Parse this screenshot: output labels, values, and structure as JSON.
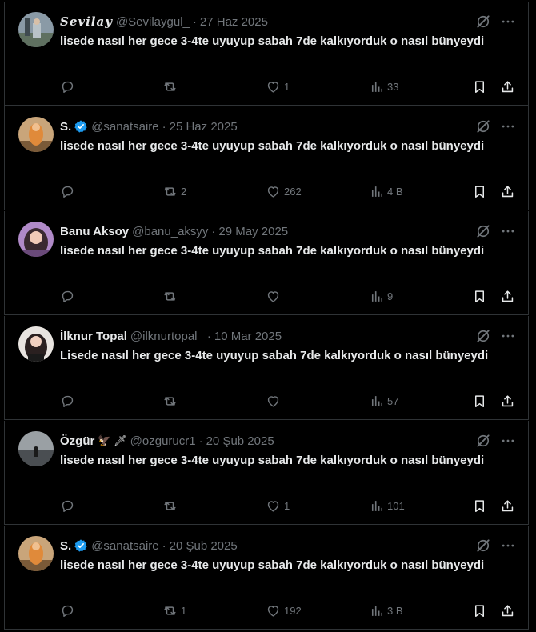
{
  "colors": {
    "background": "#000000",
    "text": "#e7e9ea",
    "muted": "#71767b",
    "border": "#2f3336",
    "verified": "#1d9bf0"
  },
  "icons": {
    "reply": "reply-icon",
    "retweet": "retweet-icon",
    "like": "heart-icon",
    "views": "views-chart-icon",
    "bookmark": "bookmark-icon",
    "share": "share-icon",
    "grok": "grok-icon",
    "more": "more-icon"
  },
  "tweets": [
    {
      "name": "𝑺𝒆𝒗𝒊𝒍𝒂𝒚",
      "handle": "@Sevilaygul_",
      "separator": "·",
      "date": "27 Haz 2025",
      "verified": false,
      "text": "lisede nasıl her gece 3-4te uyuyup sabah 7de kalkıyorduk o nasıl bünyeydi",
      "replies": "",
      "retweets": "",
      "likes": "1",
      "views": "33"
    },
    {
      "name": "S.",
      "handle": "@sanatsaire",
      "separator": "·",
      "date": "25 Haz 2025",
      "verified": true,
      "text": "lisede nasıl her gece 3-4te uyuyup sabah 7de kalkıyorduk o nasıl bünyeydi",
      "replies": "",
      "retweets": "2",
      "likes": "262",
      "views": "4 B"
    },
    {
      "name": "Banu Aksoy",
      "handle": "@banu_aksyy",
      "separator": "·",
      "date": "29 May 2025",
      "verified": false,
      "text": "lisede nasıl her gece 3-4te uyuyup sabah 7de kalkıyorduk o nasıl bünyeydi",
      "replies": "",
      "retweets": "",
      "likes": "",
      "views": "9"
    },
    {
      "name": "İlknur Topal",
      "handle": "@ilknurtopal_",
      "separator": "·",
      "date": "10 Mar 2025",
      "verified": false,
      "text": "Lisede nasıl her gece 3-4te uyuyup sabah 7de kalkıyorduk o nasıl bünyeydi",
      "replies": "",
      "retweets": "",
      "likes": "",
      "views": "57"
    },
    {
      "name": "Özgür",
      "name_emoji": "🦅 🗡",
      "handle": "@ozgurucr1",
      "separator": "·",
      "date": "20 Şub 2025",
      "verified": false,
      "text": "lisede nasıl her gece 3-4te uyuyup sabah 7de kalkıyorduk o nasıl bünyeydi",
      "replies": "",
      "retweets": "",
      "likes": "1",
      "views": "101"
    },
    {
      "name": "S.",
      "handle": "@sanatsaire",
      "separator": "·",
      "date": "20 Şub 2025",
      "verified": true,
      "text": "lisede nasıl her gece 3-4te uyuyup sabah 7de kalkıyorduk o nasıl bünyeydi",
      "replies": "",
      "retweets": "1",
      "likes": "192",
      "views": "3 B"
    }
  ]
}
